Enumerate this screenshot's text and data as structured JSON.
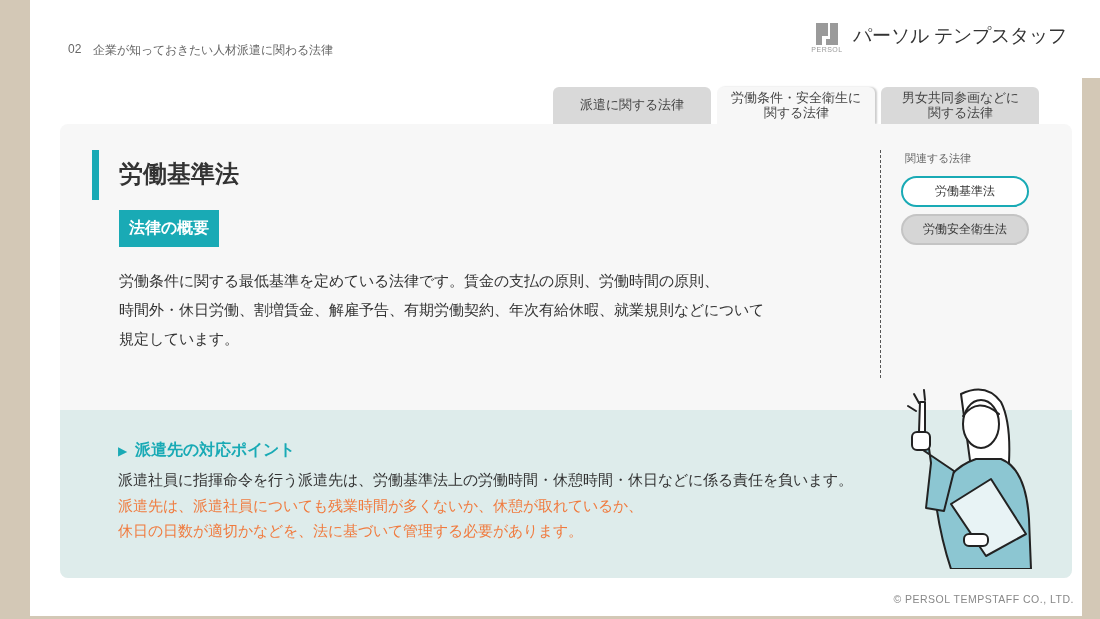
{
  "header": {
    "section_number": "02",
    "section_title": "企業が知っておきたい人材派遣に関わる法律",
    "logo_mark_text": "PERSOL",
    "logo_text": "パーソル テンプスタッフ"
  },
  "tabs": [
    {
      "label_lines": [
        "派遣に関する法律"
      ],
      "selected": false
    },
    {
      "label_lines": [
        "労働条件・安全衛生に",
        "関する法律"
      ],
      "selected": true
    },
    {
      "label_lines": [
        "男女共同参画などに",
        "関する法律"
      ],
      "selected": false
    }
  ],
  "law": {
    "title": "労働基準法",
    "overview_label": "法律の概要",
    "overview_lines": [
      "労働条件に関する最低基準を定めている法律です。賃金の支払の原則、労働時間の原則、",
      "時間外・休日労働、割増賃金、解雇予告、有期労働契約、年次有給休暇、就業規則などについて",
      "規定しています。"
    ]
  },
  "related": {
    "heading": "関連する法律",
    "items": [
      {
        "label": "労働基準法",
        "selected": true
      },
      {
        "label": "労働安全衛生法",
        "selected": false
      }
    ]
  },
  "point": {
    "marker": "▶",
    "heading": "派遣先の対応ポイント",
    "text": "派遣社員に指揮命令を行う派遣先は、労働基準法上の労働時間・休憩時間・休日などに係る責任を負います。",
    "note_lines": [
      "派遣先は、派遣社員についても残業時間が多くないか、休憩が取れているか、",
      "休日の日数が適切かなどを、法に基づいて管理する必要があります。"
    ]
  },
  "copyright": "© PERSOL TEMPSTAFF CO., LTD."
}
